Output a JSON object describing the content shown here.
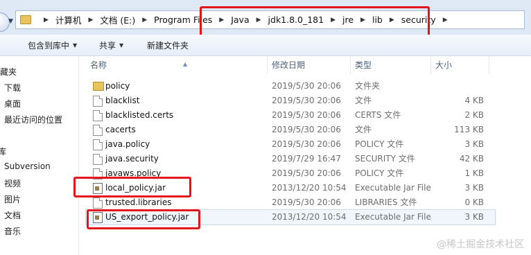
{
  "address_bar": {
    "crumbs": [
      "计算机",
      "文档 (E:)",
      "Program Files",
      "Java",
      "jdk1.8.0_181",
      "jre",
      "lib",
      "security"
    ]
  },
  "toolbar": {
    "include_in_library": "包含到库中",
    "share": "共享",
    "new_folder": "新建文件夹"
  },
  "nav_pane": {
    "items": [
      "收藏夹",
      "下载",
      "桌面",
      "最近访问的位置",
      "库",
      "Subversion",
      "视频",
      "图片",
      "文档",
      "音乐"
    ]
  },
  "columns": {
    "name": "名称",
    "date": "修改日期",
    "type": "类型",
    "size": "大小"
  },
  "files": [
    {
      "name": "policy",
      "date": "2019/5/30 20:06",
      "type": "文件夹",
      "size": "",
      "icon": "folder-icon"
    },
    {
      "name": "blacklist",
      "date": "2019/5/30 20:06",
      "type": "文件",
      "size": "4 KB",
      "icon": "file-icon"
    },
    {
      "name": "blacklisted.certs",
      "date": "2019/5/30 20:06",
      "type": "CERTS 文件",
      "size": "2 KB",
      "icon": "file-icon"
    },
    {
      "name": "cacerts",
      "date": "2019/5/30 20:06",
      "type": "文件",
      "size": "113 KB",
      "icon": "file-icon"
    },
    {
      "name": "java.policy",
      "date": "2019/5/30 20:06",
      "type": "POLICY 文件",
      "size": "3 KB",
      "icon": "file-icon"
    },
    {
      "name": "java.security",
      "date": "2019/7/29 16:47",
      "type": "SECURITY 文件",
      "size": "42 KB",
      "icon": "file-icon"
    },
    {
      "name": "javaws.policy",
      "date": "2019/5/30 20:06",
      "type": "POLICY 文件",
      "size": "1 KB",
      "icon": "file-icon"
    },
    {
      "name": "local_policy.jar",
      "date": "2013/12/20 10:54",
      "type": "Executable Jar File",
      "size": "3 KB",
      "icon": "jar-icon"
    },
    {
      "name": "trusted.libraries",
      "date": "2019/5/30 20:06",
      "type": "LIBRARIES 文件",
      "size": "0 KB",
      "icon": "file-icon"
    },
    {
      "name": "US_export_policy.jar",
      "date": "2013/12/20 10:54",
      "type": "Executable Jar File",
      "size": "3 KB",
      "icon": "jar-icon"
    }
  ],
  "watermark": "@稀土掘金技术社区",
  "colors": {
    "highlight": "#e5141b",
    "folder": "#e9c35b",
    "selection": "#f1f6fd"
  }
}
